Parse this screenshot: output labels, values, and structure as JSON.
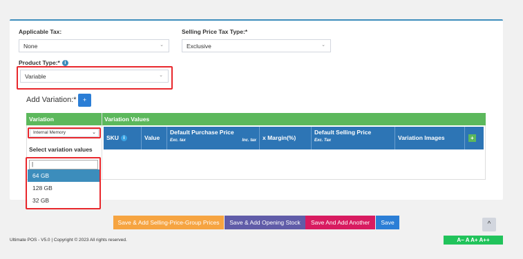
{
  "form": {
    "applicable_tax": {
      "label": "Applicable Tax:",
      "value": "None"
    },
    "selling_price_tax_type": {
      "label": "Selling Price Tax Type:*",
      "value": "Exclusive"
    },
    "product_type": {
      "label": "Product Type:*",
      "value": "Variable"
    },
    "add_variation": {
      "label": "Add Variation:*",
      "button": "+"
    }
  },
  "variation_table": {
    "headers": [
      "Variation",
      "Variation Values"
    ],
    "variation_select": "Internal Memory",
    "select_values_label": "Select variation values",
    "value_columns": [
      {
        "label": "SKU"
      },
      {
        "label": "Value"
      },
      {
        "label": "Default Purchase Price",
        "sub_left": "Exc. tax",
        "sub_right": "Inc. tax"
      },
      {
        "label": "x Margin(%)"
      },
      {
        "label": "Default Selling Price",
        "sub_left": "Exc. Tax"
      },
      {
        "label": "Variation Images"
      }
    ],
    "add_row_button": "+"
  },
  "dropdown": {
    "search_value": "|",
    "options": [
      "64 GB",
      "128 GB",
      "32 GB"
    ],
    "highlighted": "64 GB"
  },
  "actions": {
    "save_selling_price_group": "Save & Add Selling-Price-Group Prices",
    "save_opening_stock": "Save & Add Opening Stock",
    "save_and_add_another": "Save And Add Another",
    "save": "Save"
  },
  "footer": {
    "copyright": "Ultimate POS - V5.0 | Copyright © 2023 All rights reserved.",
    "scroll_top": "^",
    "font_sizes": "A−  A  A+  A++"
  },
  "colors": {
    "primary": "#3c8dbc",
    "success": "#5cb85c",
    "orange": "#f0ad4e",
    "purple": "#605ca8",
    "danger": "#d81b60",
    "blue": "#2b7ed6",
    "highlight_red": "#e8262b"
  }
}
